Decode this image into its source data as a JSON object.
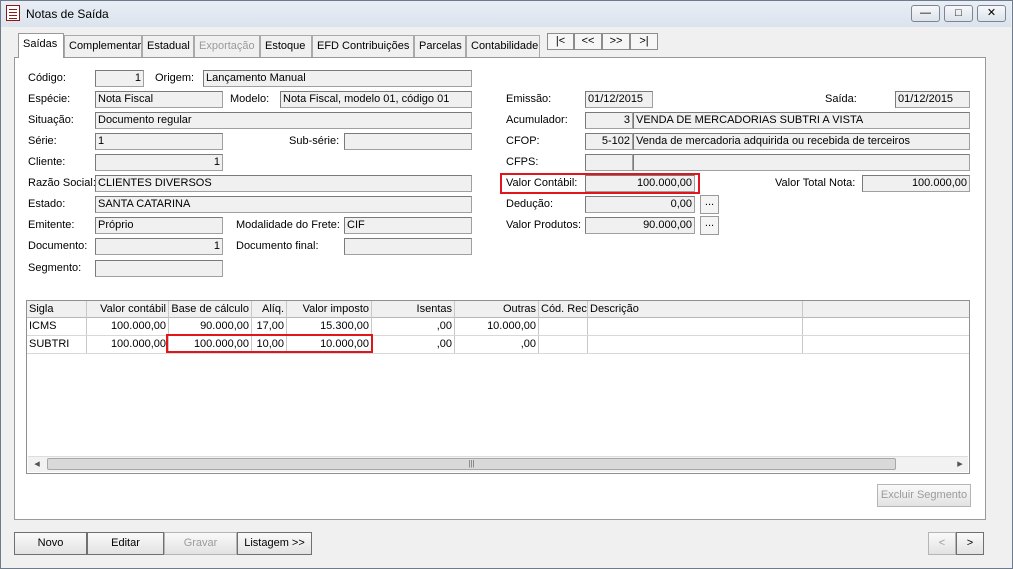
{
  "window": {
    "title": "Notas de Saída",
    "minimize": "—",
    "maximize": "□",
    "close": "✕"
  },
  "tabs": [
    "Saídas",
    "Complementar",
    "Estadual",
    "Exportação",
    "Estoque",
    "EFD Contribuições",
    "Parcelas",
    "Contabilidade"
  ],
  "nav": {
    "first": "|<",
    "prev": "<<",
    "next": ">>",
    "last": ">|"
  },
  "form": {
    "codigo_label": "Código:",
    "codigo": "1",
    "origem_label": "Origem:",
    "origem": "Lançamento Manual",
    "especie_label": "Espécie:",
    "especie": "Nota Fiscal",
    "modelo_label": "Modelo:",
    "modelo": "Nota Fiscal, modelo 01, código 01",
    "situacao_label": "Situação:",
    "situacao": "Documento regular",
    "serie_label": "Série:",
    "serie": "1",
    "subserie_label": "Sub-série:",
    "subserie": "",
    "cliente_label": "Cliente:",
    "cliente": "1",
    "razao_label": "Razão Social:",
    "razao": "CLIENTES DIVERSOS",
    "estado_label": "Estado:",
    "estado": "SANTA CATARINA",
    "emitente_label": "Emitente:",
    "emitente": "Próprio",
    "frete_label": "Modalidade do Frete:",
    "frete": "CIF",
    "documento_label": "Documento:",
    "documento": "1",
    "docfinal_label": "Documento final:",
    "docfinal": "",
    "segmento_label": "Segmento:",
    "segmento": "",
    "emissao_label": "Emissão:",
    "emissao": "01/12/2015",
    "saida_label": "Saída:",
    "saida": "01/12/2015",
    "acumulador_label": "Acumulador:",
    "acumulador_cod": "3",
    "acumulador_desc": "VENDA DE MERCADORIAS SUBTRI  A VISTA",
    "cfop_label": "CFOP:",
    "cfop_cod": "5-102",
    "cfop_desc": "Venda de mercadoria adquirida ou recebida de terceiros",
    "cfps_label": "CFPS:",
    "cfps_cod": "",
    "cfps_desc": "",
    "valor_contabil_label": "Valor Contábil:",
    "valor_contabil": "100.000,00",
    "valor_total_label": "Valor Total Nota:",
    "valor_total": "100.000,00",
    "deducao_label": "Dedução:",
    "deducao": "0,00",
    "valor_produtos_label": "Valor Produtos:",
    "valor_produtos": "90.000,00",
    "dots": "..."
  },
  "table": {
    "headers": [
      "Sigla",
      "Valor contábil",
      "Base de cálculo",
      "Alíq.",
      "Valor imposto",
      "Isentas",
      "Outras",
      "Cód. Rec.",
      "Descrição"
    ],
    "rows": [
      [
        "ICMS",
        "100.000,00",
        "90.000,00",
        "17,00",
        "15.300,00",
        ",00",
        "10.000,00",
        "",
        ""
      ],
      [
        "SUBTRI",
        "100.000,00",
        "100.000,00",
        "10,00",
        "10.000,00",
        ",00",
        ",00",
        "",
        ""
      ]
    ],
    "scroll_left": "◂",
    "scroll_right": "▸",
    "scroll_grip": "|||"
  },
  "buttons": {
    "excluir_segmento": "Excluir Segmento",
    "novo": "Novo",
    "editar": "Editar",
    "gravar": "Gravar",
    "listagem": "Listagem >>",
    "prev": "<",
    "next": ">"
  }
}
